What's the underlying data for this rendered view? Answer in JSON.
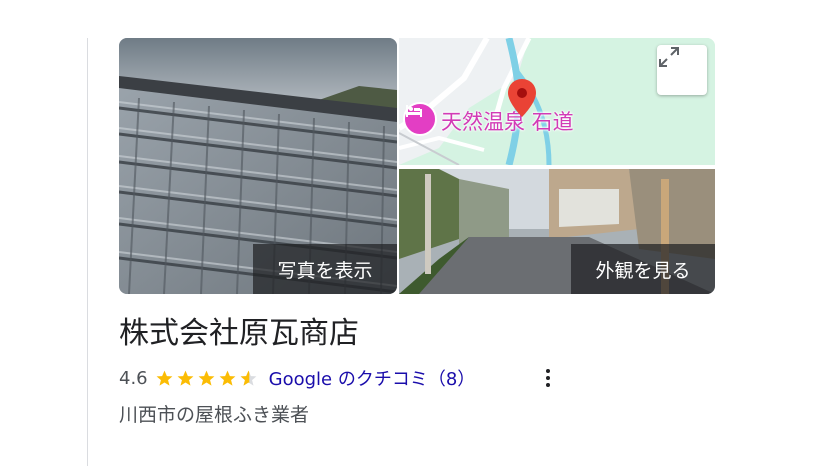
{
  "photos": {
    "view_photos_label": "写真を表示",
    "view_exterior_label": "外観を見る"
  },
  "map": {
    "place_label": "天然温泉 石道",
    "pin_color": "#ea4335",
    "label_color": "#d23bb6"
  },
  "business": {
    "name": "株式会社原瓦商店",
    "rating": "4.6",
    "rating_fraction": 0.92,
    "review_link": "Google のクチコミ（8）",
    "category": "川西市の屋根ふき業者"
  },
  "icons": {
    "expand": "expand-icon",
    "more": "more-vert-icon",
    "star_color": "#fbbc04"
  }
}
